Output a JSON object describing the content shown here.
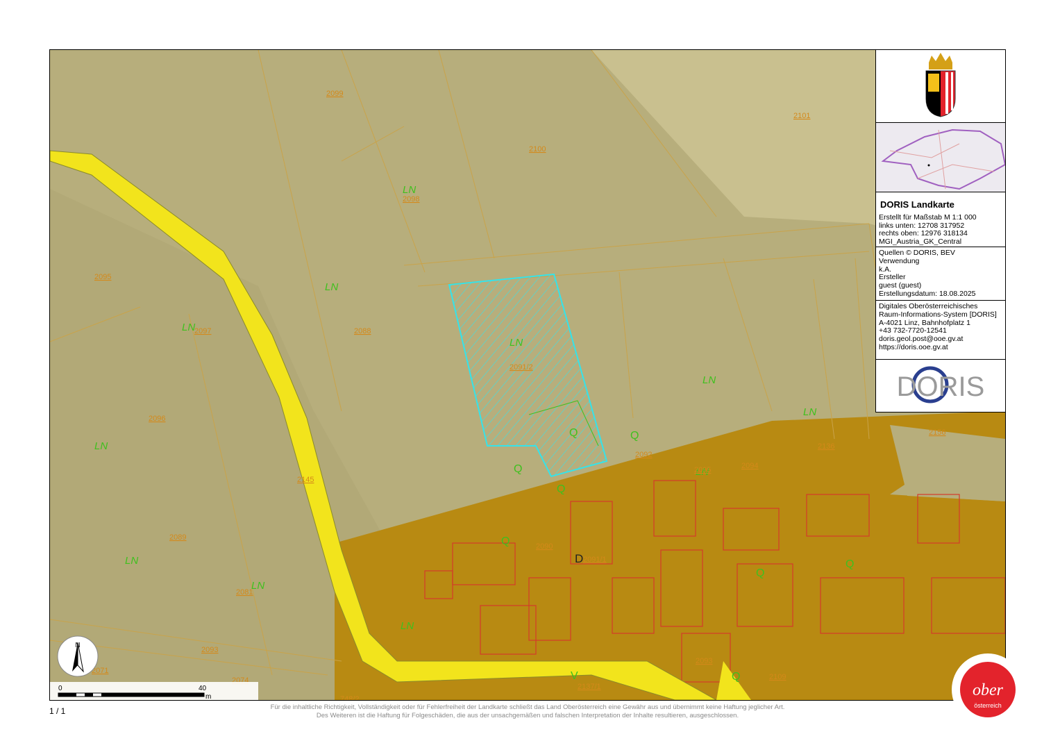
{
  "page": {
    "number_text": "1 / 1"
  },
  "disclaimer": [
    "Für die inhaltliche Richtigkeit, Vollständigkeit oder für Fehlerfreiheit der Landkarte schließt das Land Oberösterreich eine Gewähr aus und übernimmt keine Haftung jeglicher Art.",
    "Des Weiteren ist die Haftung für Folgeschäden, die aus der unsachgemäßen und falschen Interpretation der Inhalte resultieren, ausgeschlossen."
  ],
  "panel": {
    "title": "DORIS Landkarte",
    "scale": "Erstellt für Maßstab M 1:1 000",
    "lower_left": "links unten: 12708 317952",
    "upper_right": "rechts oben: 12976 318134",
    "crs": "MGI_Austria_GK_Central",
    "sources": "Quellen © DORIS, BEV",
    "usage_label": "Verwendung",
    "usage_value": "k.A.",
    "creator_label": "Ersteller",
    "creator_value": "guest (guest)",
    "date": "Erstellungsdatum: 18.08.2025",
    "org_line1": "Digitales Oberösterreichisches",
    "org_line2": "Raum-Informations-System [DORIS]",
    "address": "A-4021 Linz, Bahnhofplatz 1",
    "phone": "+43 732-7720-12541",
    "email": "doris.geol.post@ooe.gv.at",
    "website": "https://doris.ooe.gv.at",
    "doris_logo": "DORIS"
  },
  "map": {
    "north_label": "N",
    "scalebar": {
      "start": "0",
      "mid": "40",
      "unit": "m"
    },
    "land_use_labels": [
      "LN",
      "LN",
      "LN",
      "LN",
      "LN",
      "LN",
      "LN",
      "LN",
      "LN",
      "LN",
      "LN"
    ],
    "zone_labels": [
      "Q",
      "Q",
      "Q",
      "Q",
      "Q",
      "Q",
      "Q",
      "Q",
      "V",
      "D"
    ],
    "parcel_numbers": [
      "2099",
      "2100",
      "2101",
      "2098",
      "2095",
      "2097",
      "2088",
      "2096",
      "2145",
      "2089",
      "2081",
      "2093",
      "2092",
      "2094",
      "2095",
      "2091/2",
      "2090",
      "2091/1",
      "2093",
      "2136",
      "2137/1",
      "2109",
      "748/2",
      "2071",
      "2074",
      "2156"
    ],
    "oberoesterreich_logo_top": "ober",
    "oberoesterreich_logo_bottom": "österreich"
  },
  "colors": {
    "rural_zone": "#b7ae7c",
    "settlement_zone": "#b88a12",
    "road": "#f2e41c",
    "highlight": "#35e3ea",
    "land_use_text": "#3fc01e",
    "parcel_text": "#d4891a",
    "logo_red": "#e3232c",
    "doris_blue": "#2a3f8f"
  }
}
